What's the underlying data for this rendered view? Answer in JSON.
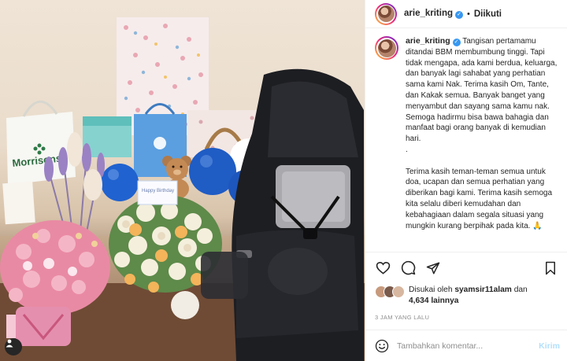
{
  "post": {
    "username": "arie_kriting",
    "follow_status": "Diikuti",
    "photo_text": {
      "shopping_bag": "Morrisons",
      "card": "Happy Birthday"
    },
    "caption": {
      "lines": [
        "Tangisan pertamamu ditandai BBM membumbung tinggi. Tapi tidak mengapa, ada kami berdua, keluarga, dan banyak lagi sahabat yang perhatian sama kami Nak. Terima kasih Om, Tante, dan Kakak semua. Banyak banget yang menyambut dan sayang sama kamu nak. Semoga hadirmu bisa bawa bahagia dan manfaat bagi orang banyak di kemudian hari.",
        ".",
        "Terima kasih teman-teman semua untuk doa, ucapan dan semua perhatian yang diberikan bagi kami. Terima kasih semoga kita selalu diberi kemudahan dan kebahagiaan dalam segala situasi yang mungkin kurang berpihak pada kita. 🙏"
      ]
    },
    "likes": {
      "prefix": "Disukai oleh",
      "user": "syamsir11alam",
      "connector": "dan",
      "others": "4,634 lainnya"
    },
    "timestamp": "3 JAM YANG LALU",
    "comment_input": {
      "placeholder": "Tambahkan komentar...",
      "value": ""
    },
    "post_button": "Kirim"
  },
  "icons": {
    "user_tag": "person-icon",
    "verified": "verified-badge-icon",
    "like": "heart-icon",
    "comment": "comment-bubble-icon",
    "share": "paper-plane-icon",
    "save": "bookmark-icon",
    "emoji": "smiley-icon"
  },
  "colors": {
    "verified_blue": "#3897f0",
    "post_button_disabled": "#b2dffc",
    "muted_text": "#8e8e8e"
  }
}
